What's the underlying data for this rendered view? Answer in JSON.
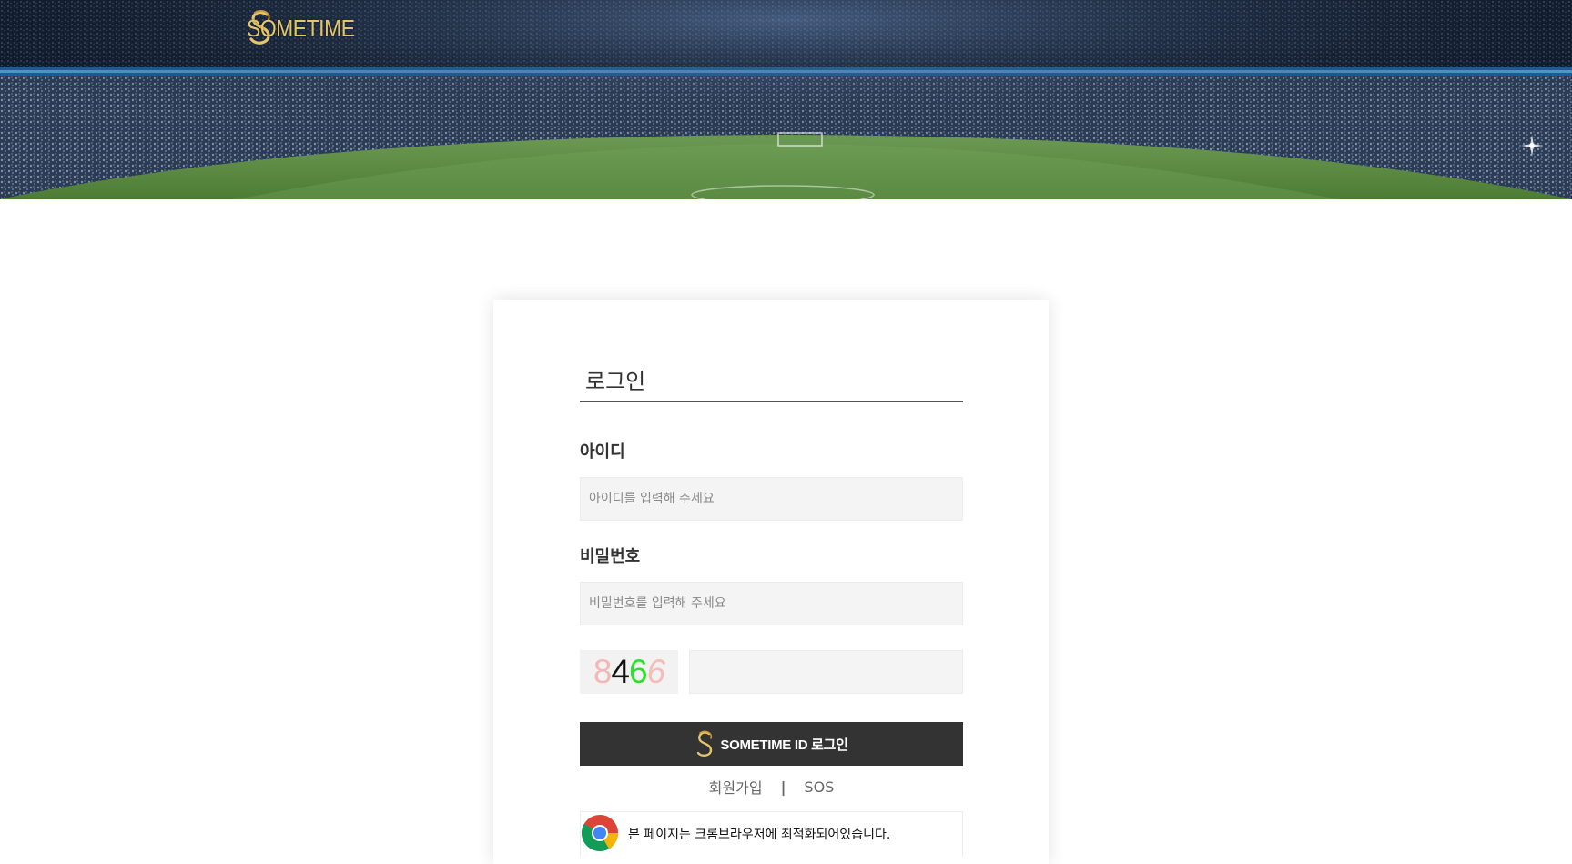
{
  "brand": {
    "name": "SOMETIME",
    "gold": "#e6c46a"
  },
  "login": {
    "title": "로그인",
    "id_label": "아이디",
    "id_placeholder": "아이디를 입력해 주세요",
    "password_label": "비밀번호",
    "password_placeholder": "비밀번호를 입력해 주세요",
    "captcha_digits": [
      "8",
      "4",
      "6",
      "6"
    ],
    "captcha_value": "",
    "submit_label": "SOMETIME ID 로그인"
  },
  "links": {
    "signup": "회원가입",
    "separator": "|",
    "sos": "SOS"
  },
  "notice": {
    "text": "본 페이지는 크롬브라우저에 최적화되어있습니다.",
    "icon": "chrome-icon"
  },
  "colors": {
    "button_bg": "#333333",
    "input_bg": "#f4f4f4"
  }
}
